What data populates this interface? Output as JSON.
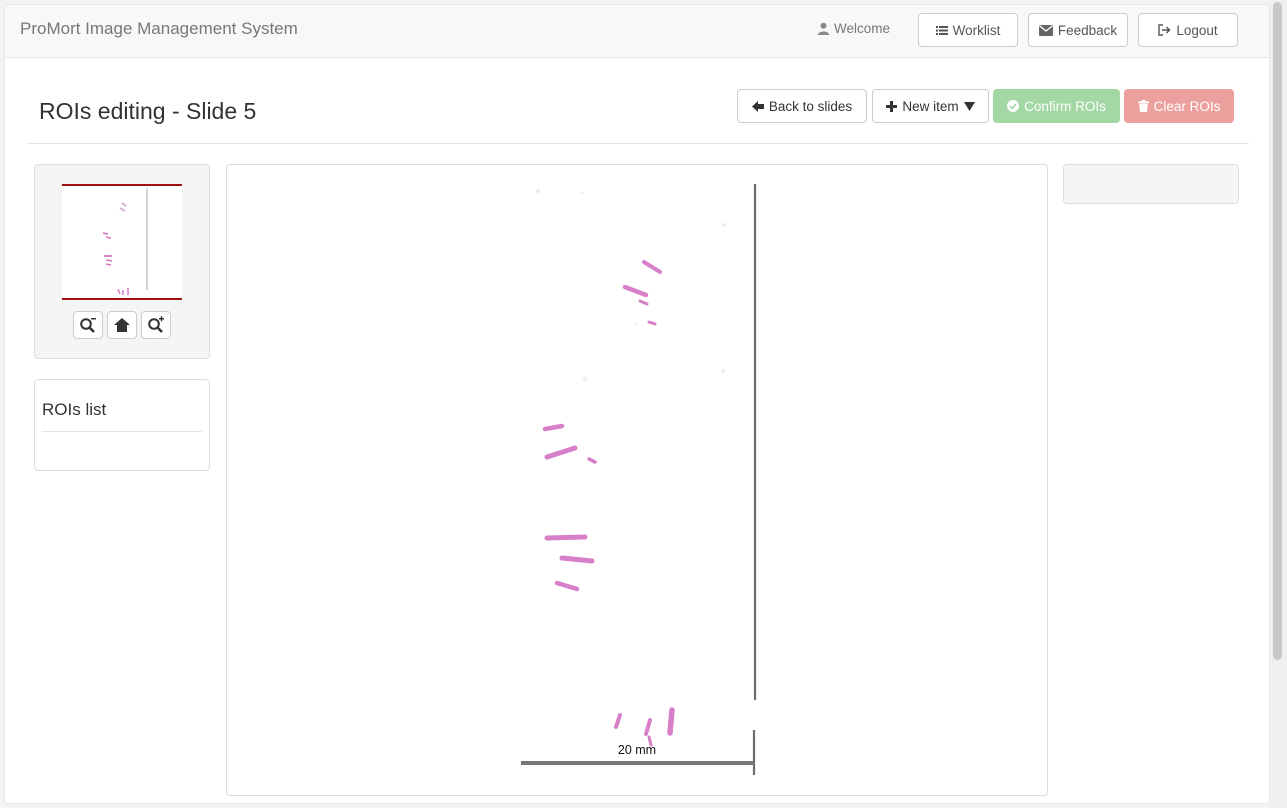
{
  "navbar": {
    "brand": "ProMort Image Management System",
    "welcome": "Welcome",
    "worklist": "Worklist",
    "feedback": "Feedback",
    "logout": "Logout"
  },
  "page": {
    "title": "ROIs editing - Slide 5"
  },
  "toolbar": {
    "back": "Back to slides",
    "new_item": "New item",
    "confirm": "Confirm ROIs",
    "clear": "Clear ROIs"
  },
  "navigator": {
    "zoom_out_icon": "zoom-out-icon",
    "home_icon": "home-icon",
    "zoom_in_icon": "zoom-in-icon"
  },
  "rois": {
    "title": "ROIs list"
  },
  "viewer": {
    "scale_label": "20 mm"
  },
  "colors": {
    "tissue": "#d77fc9",
    "confirm_bg": "#a3d7a3",
    "clear_bg": "#eba09e",
    "navigator_border": "#a01010"
  }
}
